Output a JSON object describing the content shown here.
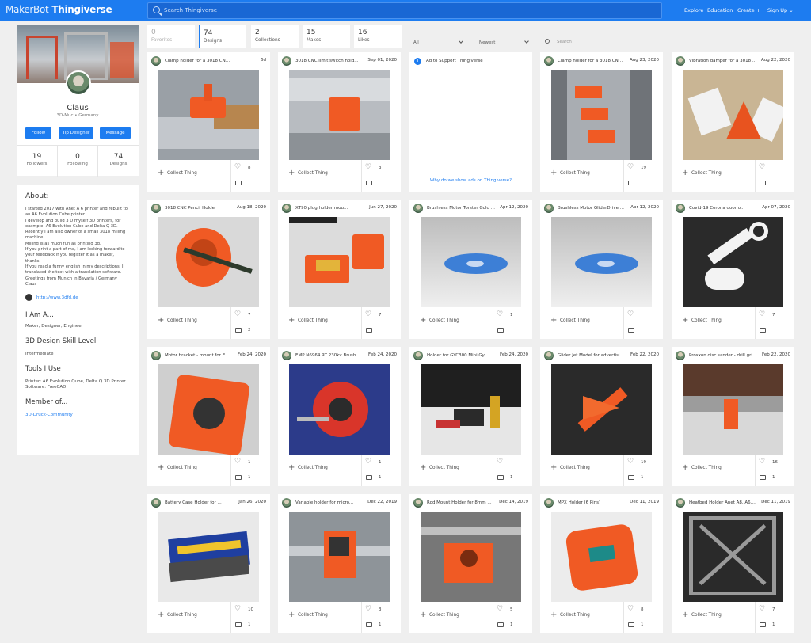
{
  "header": {
    "logo_bold": "MakerBot",
    "logo_name": "Thingiverse",
    "search_placeholder": "Search Thingiverse",
    "nav": [
      "Explore",
      "Education",
      "Create",
      "Sign Up"
    ]
  },
  "profile": {
    "name": "Claus",
    "location": "3D-Muc • Germany",
    "buttons": [
      "Follow",
      "Tip Designer",
      "Message"
    ],
    "stats": [
      {
        "value": "19",
        "label": "Followers"
      },
      {
        "value": "0",
        "label": "Following"
      },
      {
        "value": "74",
        "label": "Designs"
      }
    ]
  },
  "about": {
    "title": "About:",
    "bio": "I started 2017 with Anet A 6 printer and rebuilt to\nan A6 Evolution Cube printer.\nI develop and build 3 D myself 3D printers, for\nexample: A6 Evolution Cube and Delta Q 3D.\nRecently I am also owner of a small 3018 milling\nmachine.\nMilling is as much fun as printing 3d.\nIf you print a part of me, I am looking forward to\nyour feedback if you register it as a maker,\nthanks.\nIf you read a funny english in my descriptions, I\ntranslated the text with a translation software.\nGreetings from Munich in Bavaria / Germany\nClaus",
    "website": "http://www.3dfd.de",
    "i_am_title": "I Am A...",
    "i_am": "Maker, Designer, Engineer",
    "skill_title": "3D Design Skill Level",
    "skill": "Intermediate",
    "tools_title": "Tools I Use",
    "printer": "Printer: A6 Evolution Qube, Delta Q 3D Printer",
    "software": "Software: FreeCAD",
    "member_title": "Member of...",
    "member": "3D-Druck-Community"
  },
  "tabs": [
    {
      "value": "0",
      "label": "Favorites",
      "state": "disabled"
    },
    {
      "value": "74",
      "label": "Designs",
      "state": "active"
    },
    {
      "value": "2",
      "label": "Collections",
      "state": "normal"
    },
    {
      "value": "15",
      "label": "Makes",
      "state": "normal"
    },
    {
      "value": "16",
      "label": "Likes",
      "state": "normal"
    }
  ],
  "filters": {
    "type": "All",
    "sort": "Newest",
    "search_placeholder": "Search"
  },
  "ad": {
    "text": "Ad to Support Thingiverse",
    "why": "Why do we show ads on Thingiverse?"
  },
  "collect_label": "Collect Thing",
  "things": [
    {
      "title": "Clamp holder for a 3018 CNC mi...",
      "date": "6d",
      "likes": "8",
      "comments": "",
      "art": "clamp"
    },
    {
      "title": "3018 CNC limit switch hold...",
      "date": "Sep 01, 2020",
      "likes": "3",
      "comments": "",
      "art": "switch"
    },
    {
      "title": "Clamp holder for a 3018 CNC ...",
      "date": "Aug 23, 2020",
      "likes": "19",
      "comments": "",
      "art": "clamps3"
    },
    {
      "title": "Vibration damper for a 3018 CNC...",
      "date": "Aug 22, 2020",
      "likes": "",
      "comments": "",
      "art": "damper"
    },
    {
      "title": "3018 CNC Pencil Holder",
      "date": "Aug 18, 2020",
      "likes": "7",
      "comments": "2",
      "art": "pencil"
    },
    {
      "title": "XT90 plug holder mou...",
      "date": "Jun 27, 2020",
      "likes": "7",
      "comments": "",
      "art": "xt90"
    },
    {
      "title": "Brushless Motor Torster Gold ...",
      "date": "Apr 12, 2020",
      "likes": "1",
      "comments": "",
      "art": "disc"
    },
    {
      "title": "Brushless Motor GliderDrive ...",
      "date": "Apr 12, 2020",
      "likes": "",
      "comments": "",
      "art": "disc"
    },
    {
      "title": "Covid-19 Corona door o...",
      "date": "Apr 07, 2020",
      "likes": "7",
      "comments": "",
      "art": "hook"
    },
    {
      "title": "Motor bracket - mount for EMP ...",
      "date": "Feb 24, 2020",
      "likes": "1",
      "comments": "1",
      "art": "bracket"
    },
    {
      "title": "EMP N6964 9T 230kv Brush...",
      "date": "Feb 24, 2020",
      "likes": "1",
      "comments": "1",
      "art": "motor"
    },
    {
      "title": "Holder for GYC300 Mini Gy...",
      "date": "Feb 24, 2020",
      "likes": "",
      "comments": "1",
      "art": "gyro"
    },
    {
      "title": "Glider Jet Model for advertisi...",
      "date": "Feb 22, 2020",
      "likes": "19",
      "comments": "1",
      "art": "jet"
    },
    {
      "title": "Proxxon disc sander - drill grin...",
      "date": "Feb 22, 2020",
      "likes": "16",
      "comments": "1",
      "art": "sander"
    },
    {
      "title": "Battery Case Holder for ...",
      "date": "Jan 26, 2020",
      "likes": "10",
      "comments": "1",
      "art": "battery"
    },
    {
      "title": "Variable holder for micro...",
      "date": "Dec 22, 2019",
      "likes": "3",
      "comments": "1",
      "art": "variable"
    },
    {
      "title": "Rod Mount Holder for 8mm ...",
      "date": "Dec 14, 2019",
      "likes": "5",
      "comments": "1",
      "art": "rod"
    },
    {
      "title": "MPX Holder (6 Pins)",
      "date": "Dec 11, 2019",
      "likes": "8",
      "comments": "1",
      "art": "mpx"
    },
    {
      "title": "Heatbed Holder Anet A8, A6, H...",
      "date": "Dec 11, 2019",
      "likes": "7",
      "comments": "1",
      "art": "heatbed"
    }
  ]
}
